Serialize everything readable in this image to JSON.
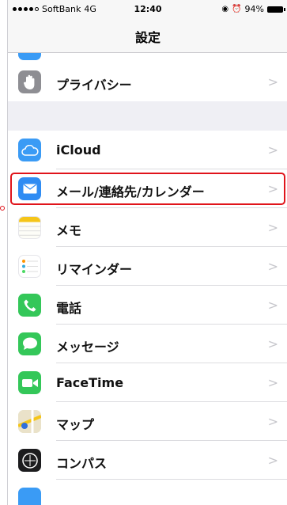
{
  "status_bar": {
    "carrier": "SoftBank",
    "network": "4G",
    "time": "12:40",
    "battery": "94%"
  },
  "nav": {
    "title": "設定"
  },
  "privacy_group": [
    {
      "label": "プライバシー",
      "icon": "hand-icon",
      "color": "#8e8e93"
    }
  ],
  "apps_group": [
    {
      "label": "iCloud",
      "icon": "cloud-icon",
      "color": "#3a9bf5"
    },
    {
      "label": "メール/連絡先/カレンダー",
      "icon": "envelope-icon",
      "color": "#2f8cf3",
      "highlighted": true
    },
    {
      "label": "メモ",
      "icon": "notes-icon",
      "color": "#f5c518"
    },
    {
      "label": "リマインダー",
      "icon": "reminders-icon",
      "color": "#ffffff"
    },
    {
      "label": "電話",
      "icon": "phone-icon",
      "color": "#34c759"
    },
    {
      "label": "メッセージ",
      "icon": "message-bubble-icon",
      "color": "#34c759"
    },
    {
      "label": "FaceTime",
      "icon": "video-camera-icon",
      "color": "#34c759"
    },
    {
      "label": "マップ",
      "icon": "map-icon",
      "color": "#d9e7c4"
    },
    {
      "label": "コンパス",
      "icon": "compass-icon",
      "color": "#1c1c1e"
    }
  ],
  "chevron": ">",
  "colors": {
    "highlight": "#e0141b",
    "accent": "#007aff"
  }
}
